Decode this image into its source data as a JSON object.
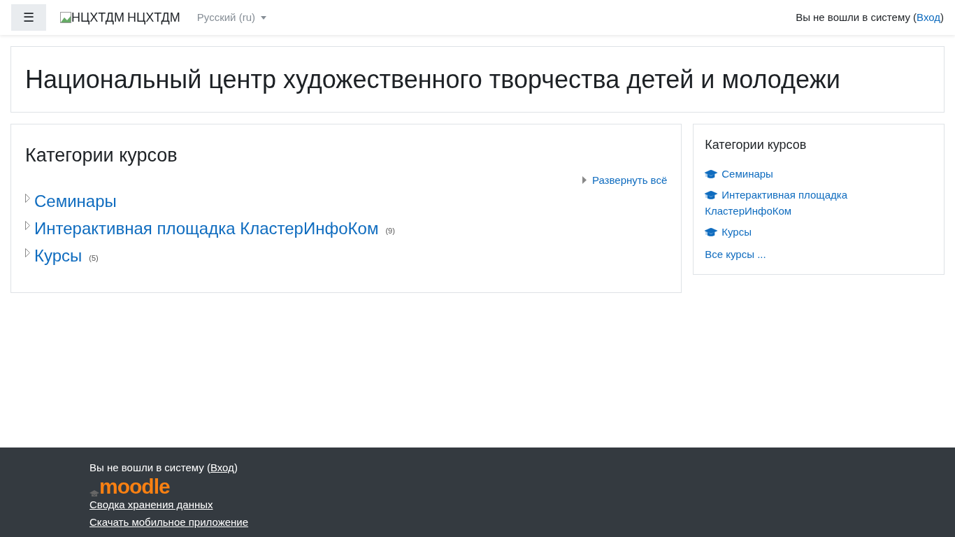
{
  "navbar": {
    "menu_icon": "☰",
    "site_logo_alt": "НЦХТДМ",
    "site_name": "НЦХТДМ",
    "language": "Русский (ru)",
    "login_notice": {
      "before": "Вы не вошли в систему (",
      "link": "Вход",
      "after": ")"
    }
  },
  "page_header": {
    "title": "Национальный центр художественного творчества детей и молодежи"
  },
  "main": {
    "title": "Категории курсов",
    "expand_all": "Развернуть всё",
    "categories": [
      {
        "name": "Семинары"
      },
      {
        "name": "Интерактивная площадка КластерИнфоКом",
        "count": "(9)"
      },
      {
        "name": "Курсы",
        "count": "(5)"
      }
    ]
  },
  "sidebar_block": {
    "title": "Категории курсов",
    "items": [
      {
        "label": "Семинары"
      },
      {
        "label": "Интерактивная площадка КластерИнфоКом"
      },
      {
        "label": "Курсы"
      }
    ],
    "all_courses": "Все курсы ..."
  },
  "footer": {
    "login_notice": {
      "before": "Вы не вошли в систему (",
      "link": "Вход",
      "after": ")"
    },
    "logo": "moodle",
    "links": [
      "Сводка хранения данных",
      "Скачать мобильное приложение"
    ]
  }
}
